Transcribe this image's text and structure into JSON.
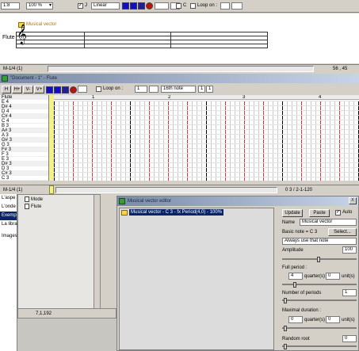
{
  "top_toolbar": {
    "time_sig": "1:8",
    "zoom": "100 %",
    "check_j": "J",
    "interpolation": "Linear",
    "check_c": "C",
    "loop_on_label": "Loop on :",
    "colors": [
      "#1010c0",
      "#1010c0",
      "#1010c0",
      "#c01010"
    ]
  },
  "score": {
    "vector_tag": "Musical vector",
    "instrument": "Flute",
    "position_left": "M-1/4 (1)",
    "coords": "56 , 45"
  },
  "doc_window": {
    "title": "\"Document - 1\" - Flute",
    "tb_h": "H",
    "tb_hplus": "H+",
    "tb_vminus": "V-",
    "tb_vplus": "V+",
    "loop_on_label": "Loop on :",
    "loop_value": "1",
    "note_value": "16th note",
    "count_a": "1",
    "count_b": "1",
    "instrument_header": "Flute",
    "notes": [
      "E 4",
      "D# 4",
      "D 4",
      "C# 4",
      "C 4",
      "B 3",
      "A# 3",
      "A 3",
      "G# 3",
      "G 3",
      "F# 3",
      "F 3",
      "E 3",
      "D# 3",
      "D 3",
      "C# 3",
      "C 3"
    ],
    "measures": [
      "1",
      "2",
      "3",
      "4"
    ],
    "position_left": "M-1/4 (1)",
    "position_right": "0 3 / 2-1-120"
  },
  "left_panel": {
    "items": [
      "L'aspe",
      "L'onde",
      "Exemp",
      "La libra",
      "Images"
    ],
    "tree_a": "Mode",
    "tree_b": "Flute",
    "coords": "7,1,192"
  },
  "vector_editor": {
    "title": "Musical vector editor",
    "close": "X",
    "list_item": "Musical vector - C 3 - fx Period(4,0) - 100%",
    "update_label": "Update",
    "paste_label": "Paste",
    "auto_label": "Auto",
    "name_label": "Name",
    "name_value": "Musical vector",
    "basic_note_label": "Basic note = C 3",
    "select_label": "Select...",
    "note_mode": "Always use that note",
    "amplitude_label": "Amplitude",
    "amplitude_value": "100",
    "full_period_label": "Full period :",
    "fp_quarters": "4",
    "fp_quarters_unit": "quarter(s)",
    "fp_units": "0",
    "fp_units_unit": "unit(s)",
    "num_periods_label": "Number of periods",
    "num_periods_value": "1",
    "max_duration_label": "Maximal duration :",
    "md_quarters": "0",
    "md_quarters_unit": "quarter(s)",
    "md_units": "0",
    "md_units_unit": "unit(s)",
    "random_root_label": "Random root",
    "random_root_value": "0"
  }
}
